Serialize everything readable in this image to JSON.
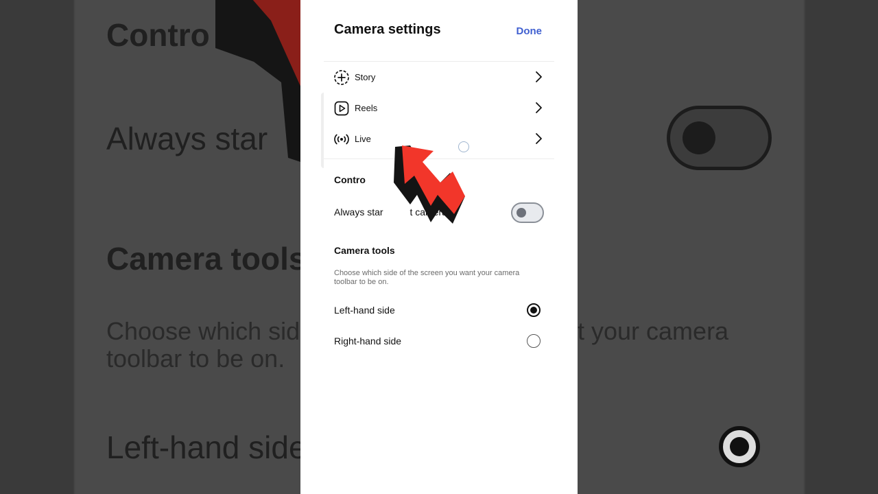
{
  "background": {
    "control_text": "Contro",
    "always_text": "Always star",
    "camera_tools_text": "Camera tools",
    "choose_line1": "Choose which sid",
    "choose_line2": "toolbar to be on.",
    "choose_right": "t your camera",
    "left_hand_text": "Left-hand side"
  },
  "header": {
    "title": "Camera settings",
    "done_label": "Done"
  },
  "nav_items": [
    {
      "label": "Story",
      "icon": "story-add-icon"
    },
    {
      "label": "Reels",
      "icon": "reels-icon"
    },
    {
      "label": "Live",
      "icon": "live-broadcast-icon"
    }
  ],
  "controls": {
    "section_title": "Contro",
    "always_start_label": "Always start in front camera",
    "always_start_visible": "Always star          t camera",
    "toggle_on": false
  },
  "camera_tools": {
    "section_title": "Camera tools",
    "description": "Choose which side of the screen you want your camera toolbar to be on.",
    "options": [
      {
        "label": "Left-hand side",
        "selected": true
      },
      {
        "label": "Right-hand side",
        "selected": false
      }
    ]
  },
  "colors": {
    "accent": "#3f5fd0",
    "arrow_red": "#f2362a",
    "arrow_dark": "#141414"
  }
}
